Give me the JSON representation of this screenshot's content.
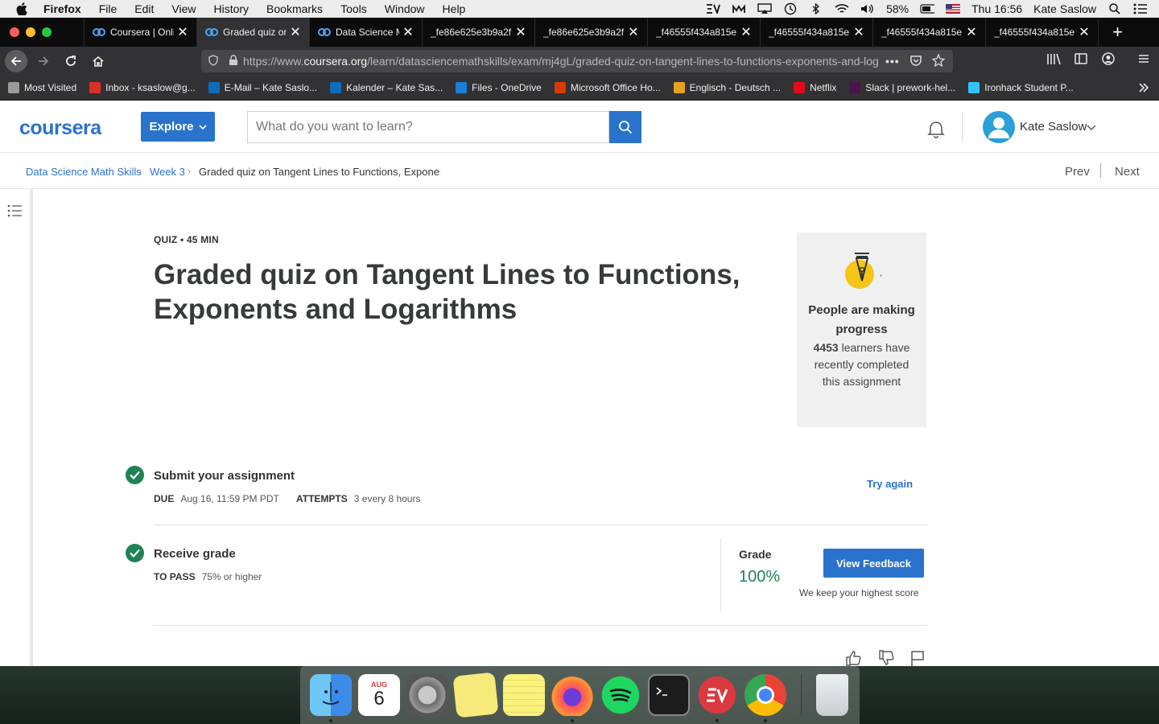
{
  "menubar": {
    "app": "Firefox",
    "items": [
      "File",
      "Edit",
      "View",
      "History",
      "Bookmarks",
      "Tools",
      "Window",
      "Help"
    ],
    "battery": "58%",
    "clock": "Thu 16:56",
    "user": "Kate Saslow"
  },
  "tabs": [
    {
      "label": "Coursera | Online",
      "active": false,
      "icon": "coursera-icon"
    },
    {
      "label": "Graded quiz on",
      "active": true,
      "icon": "coursera-icon"
    },
    {
      "label": "Data Science Math",
      "active": false,
      "icon": "coursera-icon"
    },
    {
      "label": "_fe86e625e3b9a2f",
      "active": false
    },
    {
      "label": "_fe86e625e3b9a2f",
      "active": false
    },
    {
      "label": "_f46555f434a815e",
      "active": false
    },
    {
      "label": "_f46555f434a815e",
      "active": false
    },
    {
      "label": "_f46555f434a815e",
      "active": false
    },
    {
      "label": "_f46555f434a815e",
      "active": false
    }
  ],
  "url": {
    "prefix": "https://www.",
    "host": "coursera.org",
    "path": "/learn/datasciencemathskills/exam/mj4gL/graded-quiz-on-tangent-lines-to-functions-exponents-and-logarithms"
  },
  "bookmarks": [
    {
      "label": "Most Visited",
      "color": "#9a9a9a"
    },
    {
      "label": "Inbox - ksaslow@g...",
      "color": "#d93025"
    },
    {
      "label": "E-Mail – Kate Saslo...",
      "color": "#0f6cbd"
    },
    {
      "label": "Kalender – Kate Sas...",
      "color": "#0f6cbd"
    },
    {
      "label": "Files - OneDrive",
      "color": "#1a7fd6"
    },
    {
      "label": "Microsoft Office Ho...",
      "color": "#d83b01"
    },
    {
      "label": "Englisch - Deutsch ...",
      "color": "#e8a020"
    },
    {
      "label": "Netflix",
      "color": "#e50914"
    },
    {
      "label": "Slack | prework-hel...",
      "color": "#4a154b"
    },
    {
      "label": "Ironhack Student P...",
      "color": "#32c3ff"
    }
  ],
  "header": {
    "logo": "coursera",
    "explore": "Explore",
    "search_placeholder": "What do you want to learn?",
    "username": "Kate Saslow"
  },
  "breadcrumb": {
    "items": [
      "Data Science Math Skills",
      "Week 3",
      "Graded quiz on Tangent Lines to Functions, Exponents and Logarithms"
    ],
    "prev": "Prev",
    "next": "Next"
  },
  "quiz": {
    "label": "QUIZ • 45 MIN",
    "title": "Graded quiz on Tangent Lines to Functions, Exponents and Logarithms"
  },
  "progress_card": {
    "heading": "People are making progress",
    "count": "4453",
    "text": " learners have recently completed this assignment"
  },
  "submit": {
    "title": "Submit your assignment",
    "due_label": "DUE",
    "due_value": "Aug 16, 11:59 PM PDT",
    "attempts_label": "ATTEMPTS",
    "attempts_value": "3 every 8 hours",
    "try_again": "Try again"
  },
  "grade": {
    "title": "Receive grade",
    "to_pass_label": "TO PASS",
    "to_pass_value": "75% or higher",
    "grade_label": "Grade",
    "grade_value": "100%",
    "view_feedback": "View Feedback",
    "keep_note": "We keep your highest score"
  },
  "dock": [
    {
      "name": "finder",
      "color": "#3d9be9"
    },
    {
      "name": "calendar",
      "color": "#ffffff"
    },
    {
      "name": "system-preferences",
      "color": "#8a8a8a"
    },
    {
      "name": "stickies",
      "color": "#f6ea7a"
    },
    {
      "name": "notes",
      "color": "#fbf27c"
    },
    {
      "name": "firefox",
      "color": "#ff7139"
    },
    {
      "name": "spotify",
      "color": "#1ed760"
    },
    {
      "name": "terminal",
      "color": "#1c1c1c"
    },
    {
      "name": "expressvpn",
      "color": "#da3940"
    },
    {
      "name": "chrome",
      "color": "#4285f4"
    },
    {
      "name": "trash",
      "color": "#d8dde0"
    }
  ],
  "calendar_icon": {
    "month": "AUG",
    "day": "6"
  },
  "colors": {
    "accent": "#2a73cc",
    "success": "#1f8354"
  }
}
